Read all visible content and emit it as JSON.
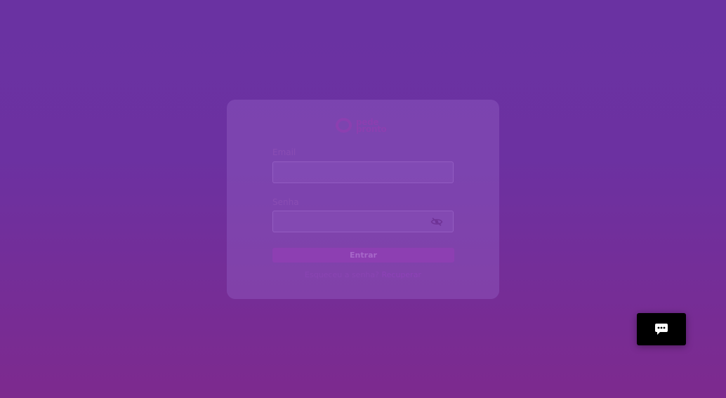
{
  "brand": {
    "logo_line1": "pede",
    "logo_line2": "pronto",
    "accent": "#8c3fb0"
  },
  "login_form": {
    "email_label": "Email",
    "email_value": "",
    "password_label": "Senha",
    "password_value": "",
    "password_toggle_icon": "eye-off-icon",
    "submit_label": "Entrar",
    "forgot_text": "Esqueceu a senha?",
    "recover_link": "Recuperar"
  },
  "chat_widget": {
    "icon": "chat-bubble-icon"
  },
  "colors": {
    "background_top": "#6a32a2",
    "background_bottom": "#7d2a8e",
    "chat_button": "#000000"
  }
}
